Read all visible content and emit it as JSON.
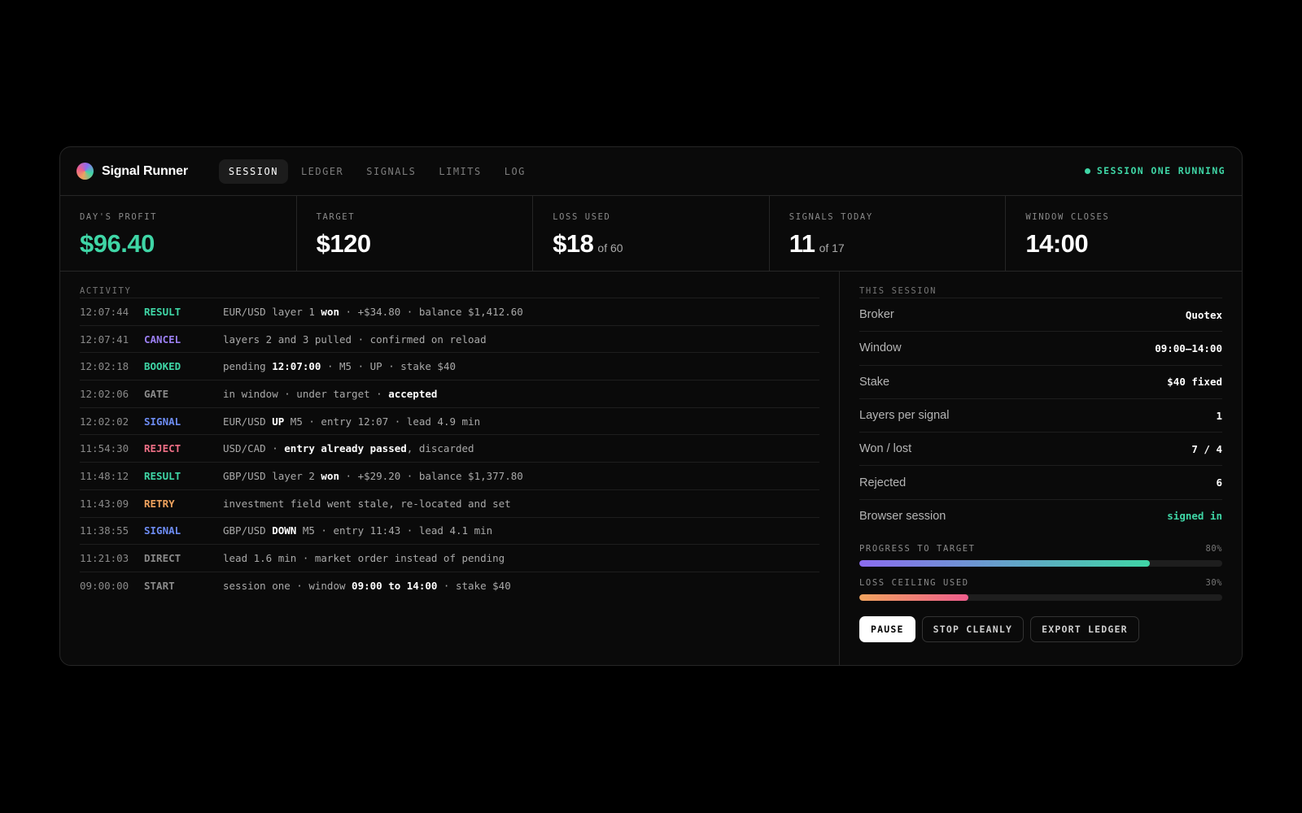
{
  "app": {
    "name": "Signal Runner"
  },
  "tabs": [
    {
      "label": "SESSION",
      "active": true
    },
    {
      "label": "LEDGER",
      "active": false
    },
    {
      "label": "SIGNALS",
      "active": false
    },
    {
      "label": "LIMITS",
      "active": false
    },
    {
      "label": "LOG",
      "active": false
    }
  ],
  "status": {
    "label": "SESSION ONE RUNNING",
    "color": "#3fd6a6"
  },
  "stats": {
    "profit": {
      "label": "DAY'S PROFIT",
      "value": "$96.40"
    },
    "target": {
      "label": "TARGET",
      "value": "$120"
    },
    "loss": {
      "label": "LOSS USED",
      "value": "$18",
      "sub": "of 60"
    },
    "signals": {
      "label": "SIGNALS TODAY",
      "value": "11",
      "sub": "of 17"
    },
    "window": {
      "label": "WINDOW CLOSES",
      "value": "14:00"
    }
  },
  "activity": {
    "label": "ACTIVITY",
    "rows": [
      {
        "time": "12:07:44",
        "tag": "RESULT",
        "tag_color": "#3fd6a6",
        "parts": [
          {
            "t": "EUR/USD layer 1 "
          },
          {
            "t": "won",
            "b": true
          },
          {
            "t": " · +$34.80 · balance $1,412.60"
          }
        ]
      },
      {
        "time": "12:07:41",
        "tag": "CANCEL",
        "tag_color": "#9b7ff2",
        "parts": [
          {
            "t": "layers 2 and 3 pulled · confirmed on reload"
          }
        ]
      },
      {
        "time": "12:02:18",
        "tag": "BOOKED",
        "tag_color": "#3fd6a6",
        "parts": [
          {
            "t": "pending "
          },
          {
            "t": "12:07:00",
            "b": true
          },
          {
            "t": " · M5 · UP · stake $40"
          }
        ]
      },
      {
        "time": "12:02:06",
        "tag": "GATE",
        "tag_color": "#8a8a8a",
        "parts": [
          {
            "t": "in window · under target · "
          },
          {
            "t": "accepted",
            "b": true
          }
        ]
      },
      {
        "time": "12:02:02",
        "tag": "SIGNAL",
        "tag_color": "#6d8cf2",
        "parts": [
          {
            "t": "EUR/USD "
          },
          {
            "t": "UP",
            "b": true
          },
          {
            "t": " M5 · entry 12:07 · lead 4.9 min"
          }
        ]
      },
      {
        "time": "11:54:30",
        "tag": "REJECT",
        "tag_color": "#ef6f86",
        "parts": [
          {
            "t": "USD/CAD · "
          },
          {
            "t": "entry already passed",
            "b": true
          },
          {
            "t": ", discarded"
          }
        ]
      },
      {
        "time": "11:48:12",
        "tag": "RESULT",
        "tag_color": "#3fd6a6",
        "parts": [
          {
            "t": "GBP/USD layer 2 "
          },
          {
            "t": "won",
            "b": true
          },
          {
            "t": " · +$29.20 · balance $1,377.80"
          }
        ]
      },
      {
        "time": "11:43:09",
        "tag": "RETRY",
        "tag_color": "#f0a35e",
        "parts": [
          {
            "t": "investment field went stale, re-located and set"
          }
        ]
      },
      {
        "time": "11:38:55",
        "tag": "SIGNAL",
        "tag_color": "#6d8cf2",
        "parts": [
          {
            "t": "GBP/USD "
          },
          {
            "t": "DOWN",
            "b": true
          },
          {
            "t": " M5 · entry 11:43 · lead 4.1 min"
          }
        ]
      },
      {
        "time": "11:21:03",
        "tag": "DIRECT",
        "tag_color": "#8a8a8a",
        "parts": [
          {
            "t": "lead 1.6 min · market order instead of pending"
          }
        ]
      },
      {
        "time": "09:00:00",
        "tag": "START",
        "tag_color": "#8a8a8a",
        "parts": [
          {
            "t": "session one · window "
          },
          {
            "t": "09:00 to 14:00",
            "b": true
          },
          {
            "t": " · stake $40"
          }
        ]
      }
    ]
  },
  "session": {
    "label": "THIS SESSION",
    "rows": [
      {
        "key": "Broker",
        "value": "Quotex"
      },
      {
        "key": "Window",
        "value": "09:00–14:00"
      },
      {
        "key": "Stake",
        "value": "$40 fixed"
      },
      {
        "key": "Layers per signal",
        "value": "1"
      },
      {
        "key": "Won / lost",
        "value": "7 / 4"
      },
      {
        "key": "Rejected",
        "value": "6"
      },
      {
        "key": "Browser session",
        "value": "signed in",
        "green": true
      }
    ],
    "progress": {
      "label": "PROGRESS TO TARGET",
      "pct_text": "80%",
      "fraction": 0.8
    },
    "loss": {
      "label": "LOSS CEILING USED",
      "pct_text": "30%",
      "fraction": 0.3
    }
  },
  "buttons": {
    "pause": "PAUSE",
    "stop": "STOP CLEANLY",
    "export": "EXPORT LEDGER"
  }
}
